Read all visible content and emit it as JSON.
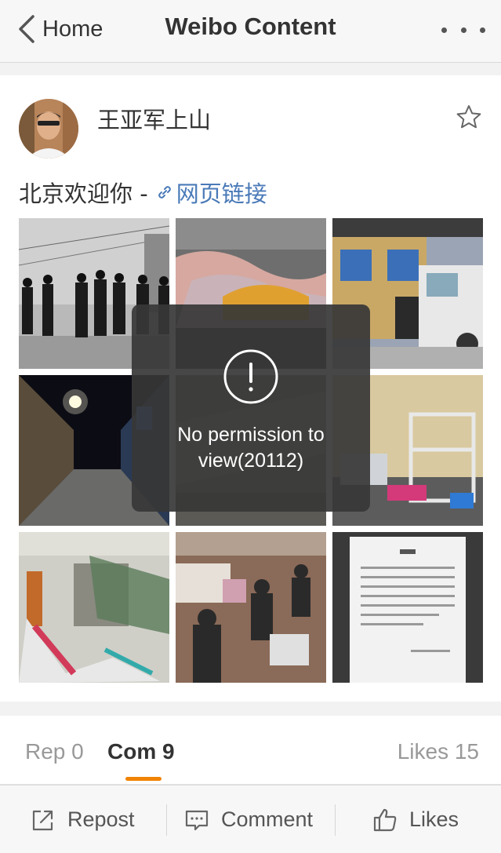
{
  "nav": {
    "back_label": "Home",
    "title": "Weibo Content",
    "more_icon": "more-dots-icon"
  },
  "post": {
    "author": "王亚军上山",
    "text": "北京欢迎你 -",
    "link_label": "网页链接",
    "link_icon": "link-icon",
    "favorite_icon": "star-icon",
    "images": [
      {
        "description": "police-in-street"
      },
      {
        "description": "bedding-on-floor"
      },
      {
        "description": "damaged-storefront-truck"
      },
      {
        "description": "night-alley"
      },
      {
        "description": "blurred-room"
      },
      {
        "description": "bunk-beds-room"
      },
      {
        "description": "demolished-interior"
      },
      {
        "description": "people-with-belongings"
      },
      {
        "description": "notice-document"
      }
    ]
  },
  "toast": {
    "icon": "exclamation-circle-icon",
    "line1": "No permission to",
    "line2": "view(20112)"
  },
  "tabs": {
    "repost": "Rep 0",
    "comment": "Com 9",
    "likes": "Likes 15",
    "active_color": "#f08300"
  },
  "toolbar": {
    "repost_label": "Repost",
    "comment_label": "Comment",
    "likes_label": "Likes"
  },
  "colors": {
    "link": "#4a7ab8",
    "accent": "#f08300",
    "toast_bg": "#373737"
  }
}
